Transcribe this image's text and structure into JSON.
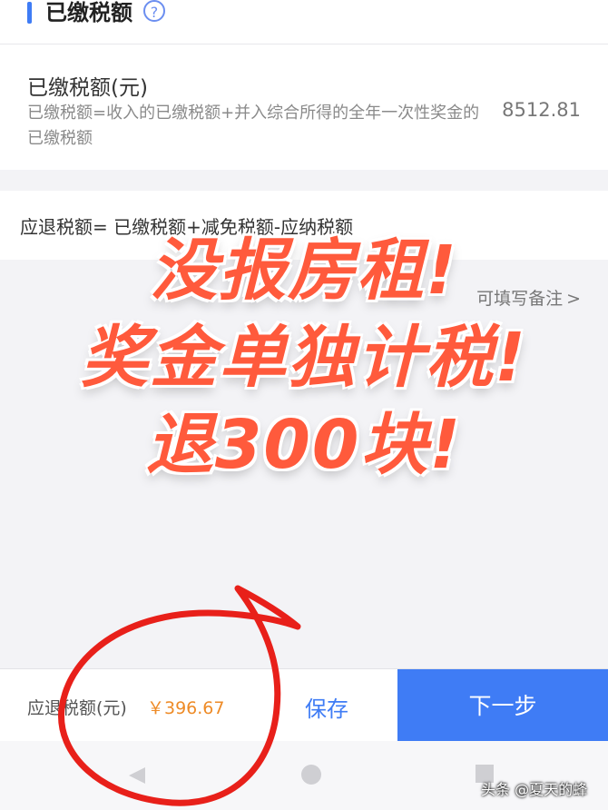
{
  "section": {
    "title": "已缴税额"
  },
  "paid_tax": {
    "label": "已缴税额(元)",
    "description": "已缴税额=收入的已缴税额+并入综合所得的全年一次性奖金的已缴税额",
    "value": "8512.81"
  },
  "formula": {
    "text": "应退税额= 已缴税额+减免税额-应纳税额"
  },
  "remark": {
    "text": "可填写备注"
  },
  "overlay": {
    "lines": [
      "没报房租!",
      "奖金单独计税!",
      "退300块!"
    ]
  },
  "bottom": {
    "refund_label": "应退税额(元)",
    "refund_value": "￥396.67",
    "save_label": "保存",
    "next_label": "下一步"
  },
  "watermark": "头条 @夏天的蜂",
  "colors": {
    "accent": "#3f7cf5",
    "refund": "#ee8b27",
    "overlay_text": "#ff5a3c",
    "annotation": "#e8201a"
  }
}
